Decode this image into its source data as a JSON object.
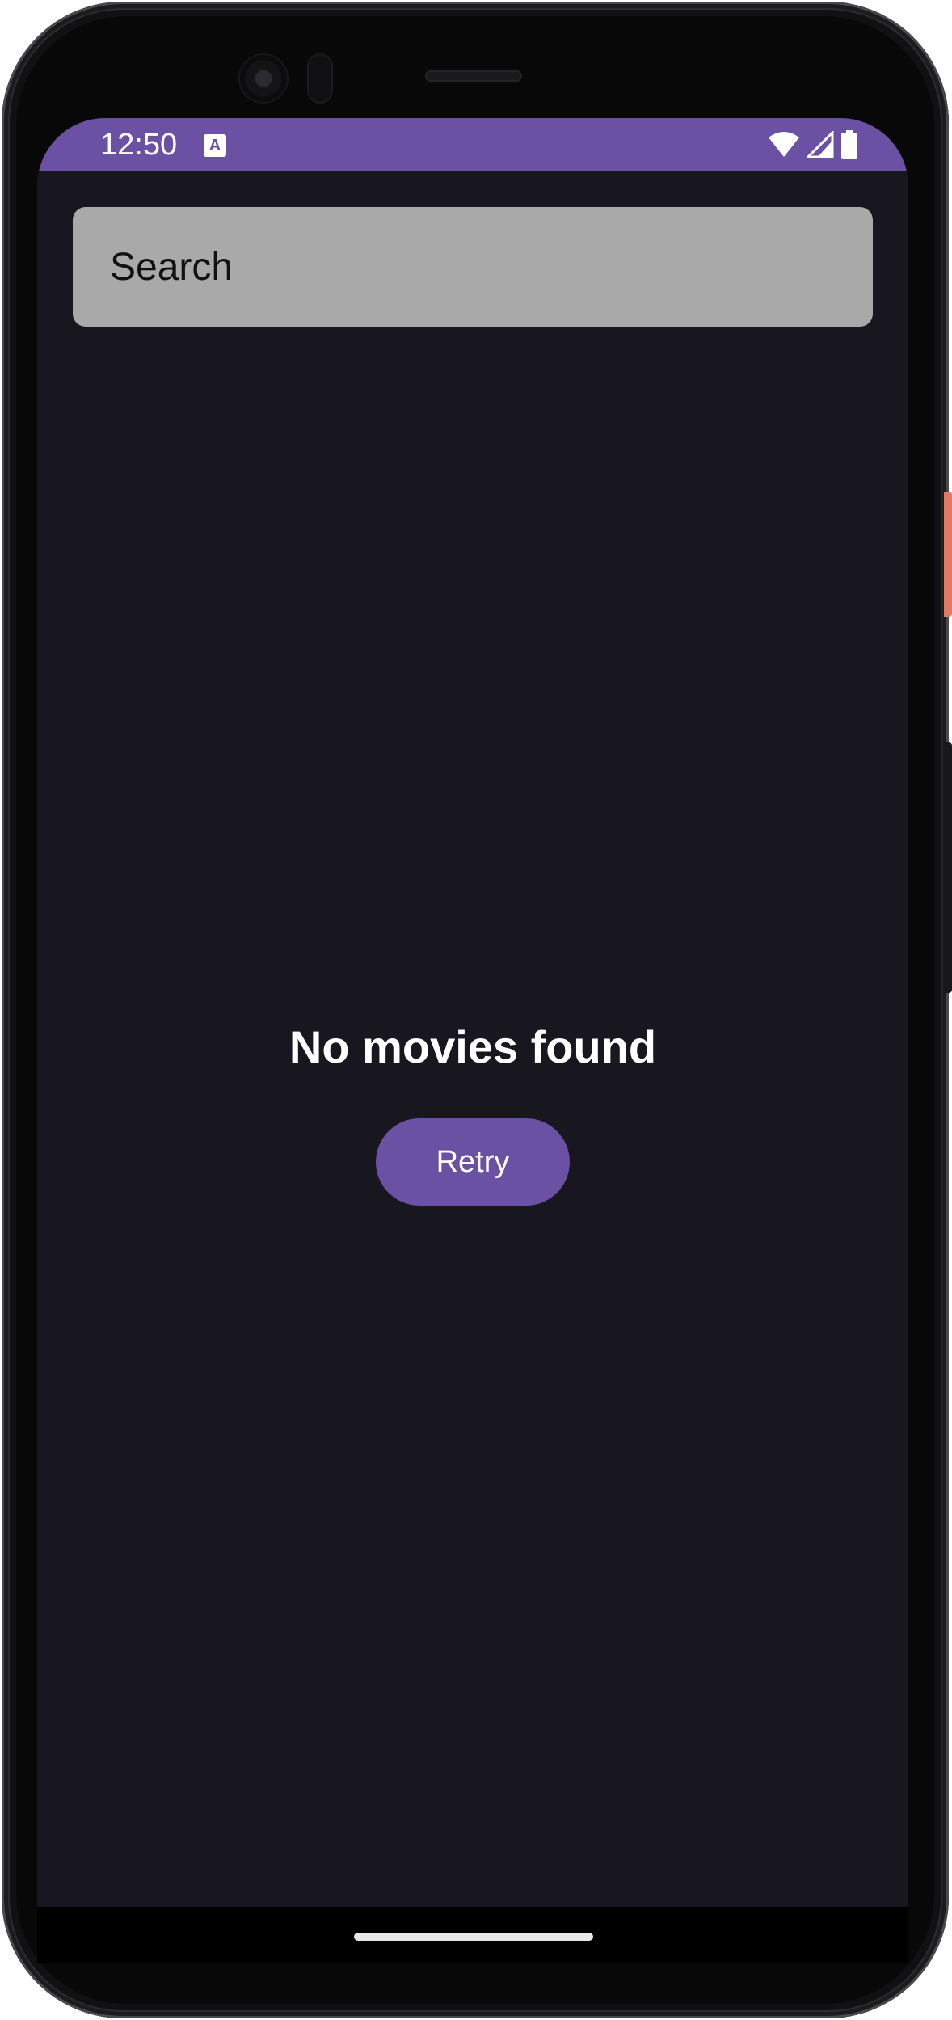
{
  "status_bar": {
    "time": "12:50",
    "notification_icon": "text-input-method-icon",
    "icons": [
      "wifi-icon",
      "cellular-signal-icon",
      "battery-icon"
    ],
    "color": "#6a51a4"
  },
  "search": {
    "placeholder": "Search",
    "value": ""
  },
  "empty_state": {
    "message": "No movies found",
    "retry_label": "Retry"
  },
  "theme": {
    "background": "#18171f",
    "accent": "#6a51a4",
    "search_field": "#a9a9a9"
  }
}
